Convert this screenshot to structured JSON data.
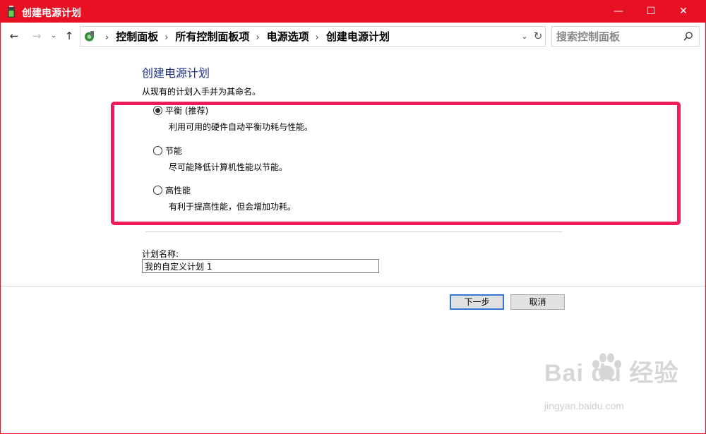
{
  "window": {
    "title": "创建电源计划",
    "accent_color": "#e81123",
    "controls": {
      "minimize": "—",
      "maximize": "☐",
      "close": "✕"
    }
  },
  "nav": {
    "back_icon": "←",
    "forward_icon": "→",
    "recent_icon": "⌄",
    "up_icon": "↑"
  },
  "address": {
    "icon": "control-panel-icon",
    "crumbs": [
      "控制面板",
      "所有控制面板项",
      "电源选项",
      "创建电源计划"
    ],
    "separator": "›",
    "dropdown_icon": "⌄",
    "refresh_icon": "↻"
  },
  "search": {
    "placeholder": "搜索控制面板",
    "value": ""
  },
  "main": {
    "heading": "创建电源计划",
    "subtext": "从现有的计划入手并为其命名。",
    "plans": [
      {
        "label": "平衡 (推荐)",
        "description": "利用可用的硬件自动平衡功耗与性能。",
        "selected": true
      },
      {
        "label": "节能",
        "description": "尽可能降低计算机性能以节能。",
        "selected": false
      },
      {
        "label": "高性能",
        "description": "有利于提高性能，但会增加功耗。",
        "selected": false
      }
    ],
    "highlight_color": "#ef1c5a",
    "plan_name_label": "计划名称:",
    "plan_name_value": "我的自定义计划 1"
  },
  "footer": {
    "next_label": "下一步",
    "cancel_label": "取消"
  },
  "watermark": {
    "logo_text": "Bai  du 经验",
    "url": "jingyan.baidu.com"
  }
}
